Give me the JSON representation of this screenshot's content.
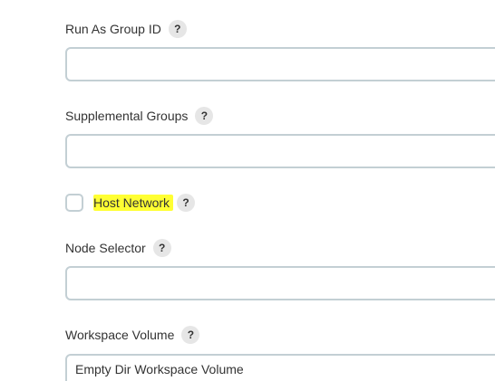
{
  "fields": {
    "run_as_group_id": {
      "label": "Run As Group ID",
      "help": "?",
      "value": "",
      "placeholder": ""
    },
    "supplemental_groups": {
      "label": "Supplemental Groups",
      "help": "?",
      "value": "",
      "placeholder": ""
    },
    "host_network": {
      "label": "Host Network",
      "help": "?",
      "checked": false
    },
    "node_selector": {
      "label": "Node Selector",
      "help": "?",
      "value": "",
      "placeholder": ""
    },
    "workspace_volume": {
      "label": "Workspace Volume",
      "help": "?",
      "selected": "Empty Dir Workspace Volume"
    }
  },
  "colors": {
    "highlight": "#ffff33",
    "input_border": "#c3cfd4",
    "help_bg": "#e6e6e6"
  }
}
